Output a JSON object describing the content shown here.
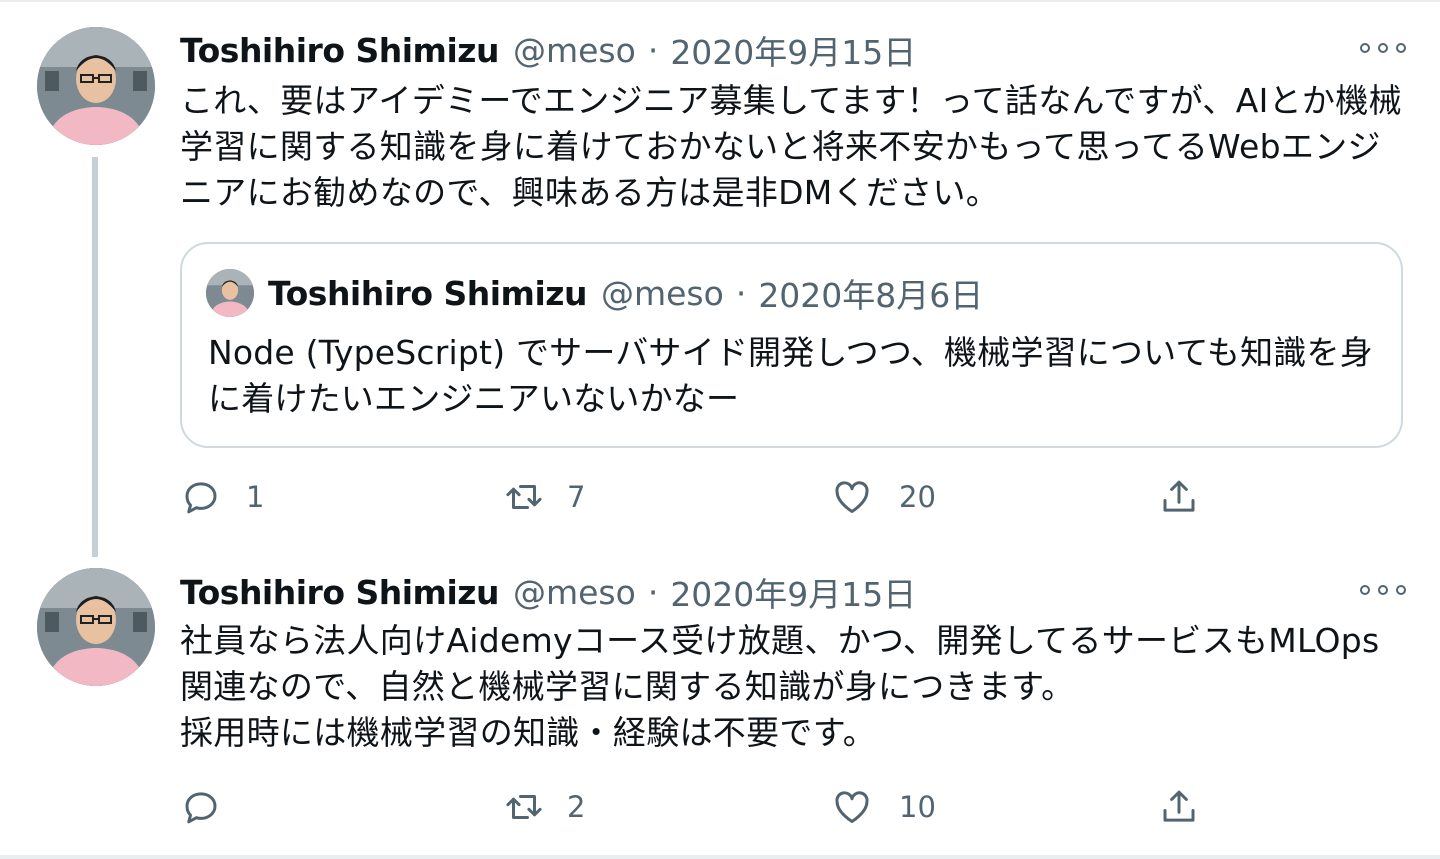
{
  "tweets": [
    {
      "author": {
        "name": "Toshihiro Shimizu",
        "handle": "@meso"
      },
      "separator": "·",
      "date": "2020年9月15日",
      "text": "これ、要はアイデミーでエンジニア募集してます！って話なんですが、AIとか機械学習に関する知識を身に着けておかないと将来不安かもって思ってるWebエンジニアにお勧めなので、興味ある方は是非DMください。",
      "quoted": {
        "author": {
          "name": "Toshihiro Shimizu",
          "handle": "@meso"
        },
        "separator": "·",
        "date": "2020年8月6日",
        "text": "Node (TypeScript) でサーバサイド開発しつつ、機械学習についても知識を身に着けたいエンジニアいないかなー"
      },
      "stats": {
        "replies": "1",
        "retweets": "7",
        "likes": "20"
      }
    },
    {
      "author": {
        "name": "Toshihiro Shimizu",
        "handle": "@meso"
      },
      "separator": "·",
      "date": "2020年9月15日",
      "text": "社員なら法人向けAidemyコース受け放題、かつ、開発してるサービスもMLOps関連なので、自然と機械学習に関する知識が身につきます。\n採用時には機械学習の知識・経験は不要です。",
      "stats": {
        "replies": "",
        "retweets": "2",
        "likes": "10"
      }
    }
  ],
  "icons": {
    "more": "more-horizontal-icon",
    "reply": "reply-bubble-icon",
    "retweet": "retweet-icon",
    "like": "heart-icon",
    "share": "share-upload-icon"
  },
  "colors": {
    "text": "#0f1419",
    "secondary": "#536471",
    "border": "#cfd9de",
    "thread_line": "#c4cfd6"
  }
}
